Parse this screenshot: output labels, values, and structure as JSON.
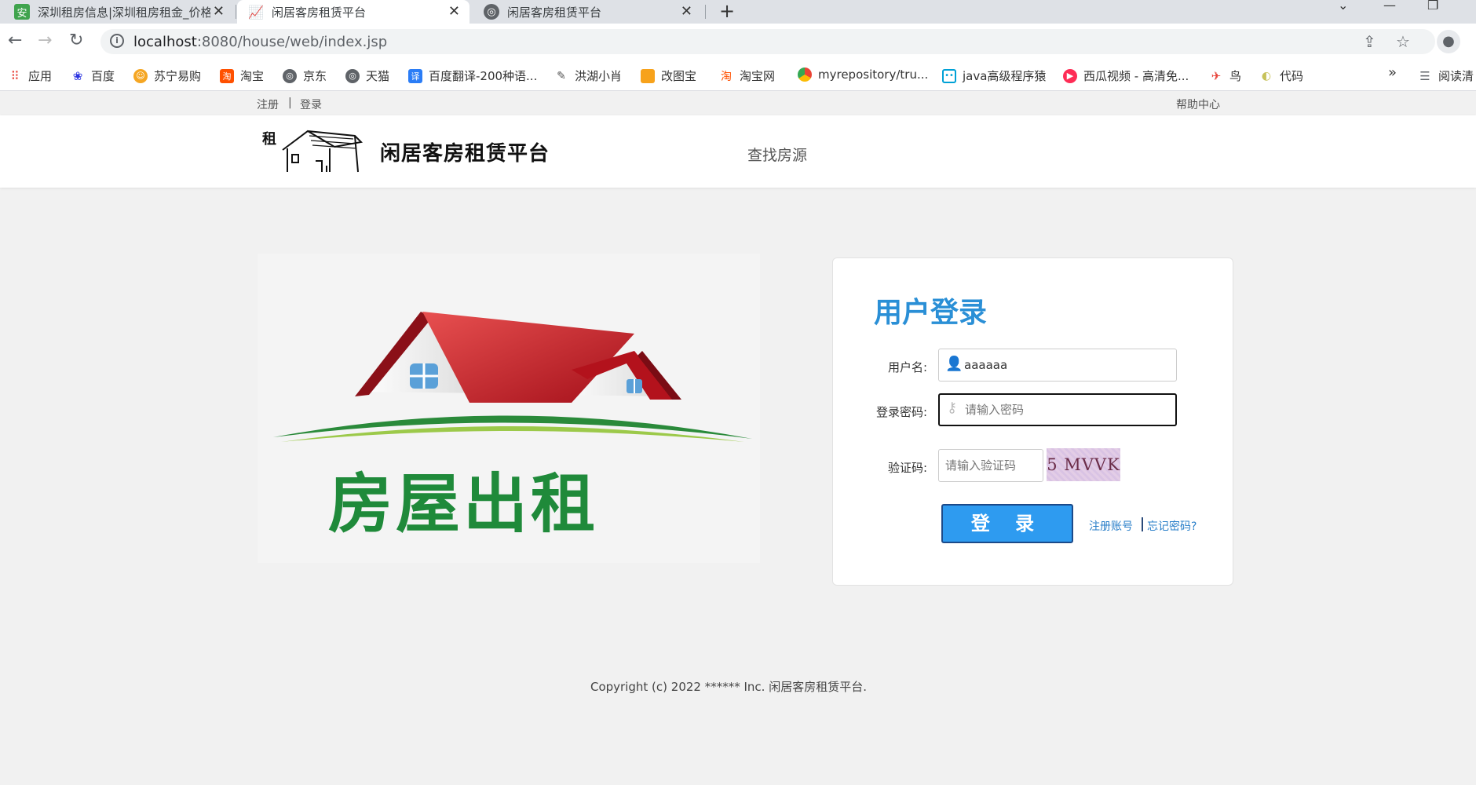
{
  "browser": {
    "tabs": [
      {
        "title": "深圳租房信息|深圳租房租金_价格",
        "icon": "green-house-icon",
        "active": false
      },
      {
        "title": "闲居客房租赁平台",
        "icon": "chart-icon",
        "active": true
      },
      {
        "title": "闲居客房租赁平台",
        "icon": "globe-icon",
        "active": false
      }
    ],
    "new_tab": "+",
    "url_host": "localhost",
    "url_path": ":8080/house/web/index.jsp",
    "bookmarks": [
      {
        "label": "应用",
        "icon": "apps-grid-icon"
      },
      {
        "label": "百度",
        "icon": "baidu-paw-icon"
      },
      {
        "label": "苏宁易购",
        "icon": "suning-icon"
      },
      {
        "label": "淘宝",
        "icon": "taobao-icon"
      },
      {
        "label": "京东",
        "icon": "globe-icon"
      },
      {
        "label": "天猫",
        "icon": "globe-icon"
      },
      {
        "label": "百度翻译-200种语...",
        "icon": "translate-icon"
      },
      {
        "label": "洪湖小肖",
        "icon": "bird-icon"
      },
      {
        "label": "改图宝",
        "icon": "orange-square-icon"
      },
      {
        "label": "淘宝网",
        "icon": "taobao-icon"
      },
      {
        "label": "myrepository/tru...",
        "icon": "chrome-icon"
      },
      {
        "label": "java高级程序猿",
        "icon": "bilibili-icon"
      },
      {
        "label": "西瓜视频 - 高清免...",
        "icon": "xigua-icon"
      },
      {
        "label": "鸟",
        "icon": "bird-icon"
      },
      {
        "label": "代码",
        "icon": "code-icon"
      }
    ],
    "more_bookmarks": "»",
    "reading_list": "阅读清"
  },
  "topbar": {
    "register": "注册",
    "divider": "|",
    "login": "登录",
    "help": "帮助中心"
  },
  "header": {
    "logo_char": "租",
    "site_name": "闲居客房租赁平台",
    "nav_find": "查找房源"
  },
  "banner": {
    "text": "房屋出租"
  },
  "login": {
    "title": "用户登录",
    "username_label": "用户名:",
    "username_value": "aaaaaa",
    "password_label": "登录密码:",
    "password_placeholder": "请输入密码",
    "captcha_label": "验证码:",
    "captcha_placeholder": "请输入验证码",
    "captcha_text": "5 MVVK",
    "submit": "登 录",
    "register_link": "注册账号",
    "forgot_link": "忘记密码?"
  },
  "footer": {
    "copyright": "Copyright (c) 2022 ****** Inc. 闲居客房租赁平台."
  },
  "colors": {
    "accent": "#2a8fd6",
    "button": "#2e9bf0",
    "banner_green": "#1f8a3a",
    "roof_red": "#c8232b"
  }
}
